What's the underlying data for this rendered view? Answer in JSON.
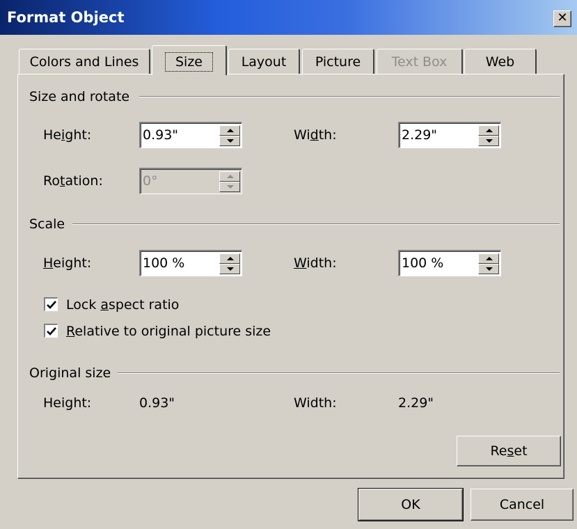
{
  "window": {
    "title": "Format Object",
    "close_glyph": "✕"
  },
  "tabs": [
    {
      "label": "Colors and Lines",
      "state": "normal"
    },
    {
      "label": "Size",
      "state": "active"
    },
    {
      "label": "Layout",
      "state": "normal"
    },
    {
      "label": "Picture",
      "state": "normal"
    },
    {
      "label": "Text Box",
      "state": "disabled"
    },
    {
      "label": "Web",
      "state": "normal"
    }
  ],
  "size_rotate": {
    "heading": "Size and rotate",
    "height_label": "Height:",
    "height_value": "0.93\"",
    "width_label": "Width:",
    "width_value": "2.29\"",
    "rotation_label": "Rotation:",
    "rotation_value": "0°"
  },
  "scale": {
    "heading": "Scale",
    "height_label": "Height:",
    "height_value": "100 %",
    "width_label": "Width:",
    "width_value": "100 %",
    "lock_aspect_label": "Lock aspect ratio",
    "lock_aspect_checked": true,
    "relative_label": "Relative to original picture size",
    "relative_checked": true
  },
  "original_size": {
    "heading": "Original size",
    "height_label": "Height:",
    "height_value": "0.93\"",
    "width_label": "Width:",
    "width_value": "2.29\""
  },
  "buttons": {
    "reset": "Reset",
    "ok": "OK",
    "cancel": "Cancel"
  },
  "icons": {
    "close": "close-icon",
    "check": "check-icon",
    "spin_up": "arrow-up-icon",
    "spin_down": "arrow-down-icon"
  }
}
